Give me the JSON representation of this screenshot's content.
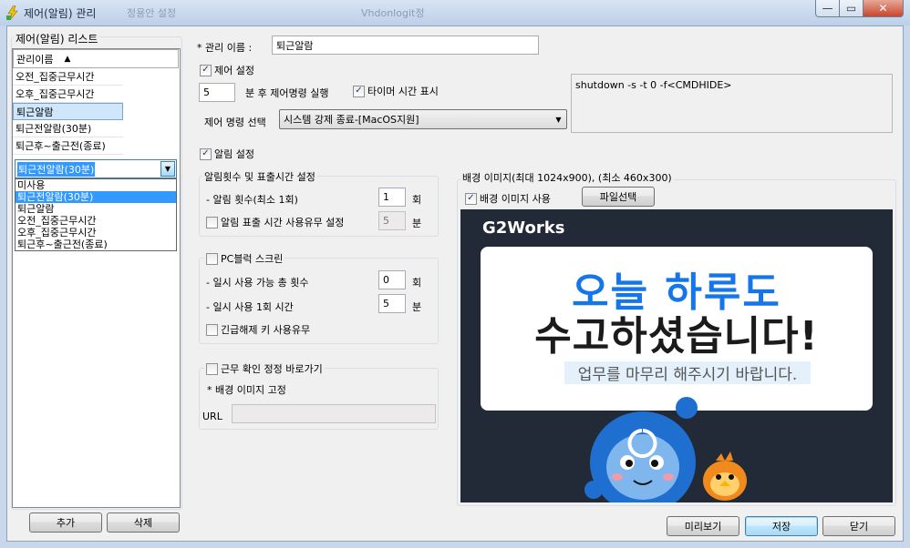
{
  "window": {
    "title": "제어(알림) 관리",
    "ghost_tabs": [
      "정용안 설정",
      "Vhdonlogit정"
    ],
    "minimize_glyph": "—",
    "maximize_glyph": "▭",
    "close_glyph": "✕"
  },
  "left": {
    "section_title": "제어(알림) 리스트",
    "column_header": "관리이름",
    "sort_icon": "▲",
    "items": [
      "오전_집중근무시간",
      "오후_집중근무시간",
      "퇴근알람",
      "퇴근전알람(30분)",
      "퇴근후~출근전(종료)"
    ],
    "selected_index": 2,
    "combo": {
      "value": "퇴근전알람(30분)",
      "options": [
        "미사용",
        "퇴근전알람(30분)",
        "퇴근알람",
        "오전_집중근무시간",
        "오후_집중근무시간",
        "퇴근후~출근전(종료)"
      ],
      "highlighted_index": 1
    },
    "add_button": "추가",
    "delete_button": "삭제"
  },
  "form": {
    "name_label": "* 관리 이름 :",
    "name_value": "퇴근알람",
    "control": {
      "checkbox_label": "제어 설정",
      "checked": true,
      "minutes_value": "5",
      "minutes_label": "분 후 제어명령 실행",
      "timer_label": "타이머 시간 표시",
      "timer_checked": true,
      "command_label": "제어 명령 선택",
      "command_value": "시스템 강제 종료-[MacOS지원]",
      "command_text": "shutdown -s -t 0 -f<CMDHIDE>"
    },
    "alert": {
      "checkbox_label": "알림 설정",
      "checked": true,
      "group_title": "알림횟수 및 표출시간 설정",
      "count_label": "- 알림 횟수(최소 1회)",
      "count_value": "1",
      "count_unit": "회",
      "display_label": "알림 표출 시간 사용유무 설정",
      "display_checked": false,
      "display_value": "5",
      "display_unit": "분"
    },
    "pc_block": {
      "checkbox_label": "PC블럭 스크린",
      "checked": false,
      "total_label": "- 일시 사용 가능 총 횟수",
      "total_value": "0",
      "total_unit": "회",
      "once_label": "- 일시 사용 1회 시간",
      "once_value": "5",
      "once_unit": "분",
      "emergency_label": "긴급해제 키 사용유무",
      "emergency_checked": false
    },
    "shortcut": {
      "checkbox_label": "근무 확인 정정 바로가기",
      "checked": false,
      "bg_fixed_label": "* 배경 이미지 고정",
      "url_label": "URL",
      "url_value": ""
    },
    "background": {
      "group_title": "배경 이미지(최대 1024x900), (최소 460x300)",
      "use_label": "배경 이미지 사용",
      "use_checked": true,
      "file_button": "파일선택",
      "brand": "G2Works",
      "headline1": "오늘 하루도",
      "headline2": "수고하셨습니다!",
      "subline": "업무를 마무리 해주시기 바랍니다."
    }
  },
  "footer": {
    "preview_button": "미리보기",
    "save_button": "저장",
    "close_button": "닫기"
  },
  "check_mark": "✓",
  "combo_arrow": "▼"
}
